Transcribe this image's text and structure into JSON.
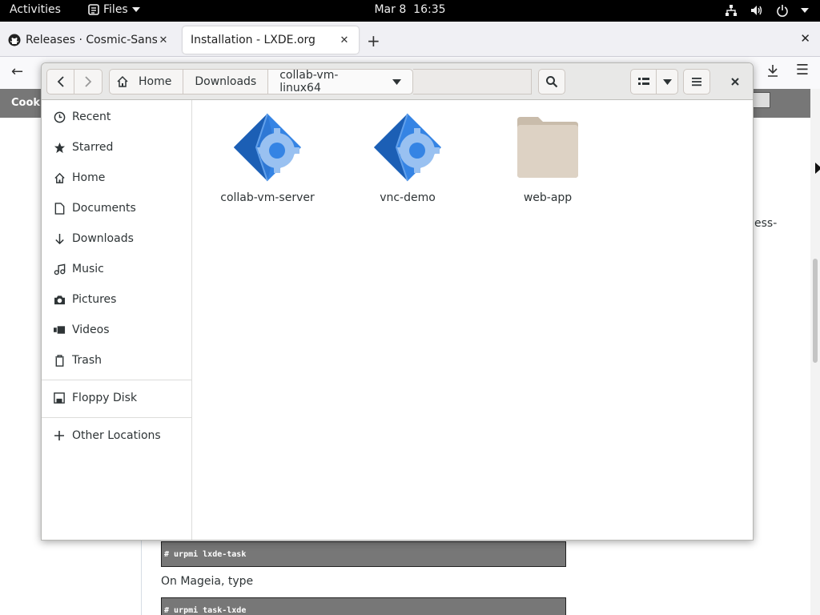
{
  "topbar": {
    "activities": "Activities",
    "app_menu": "Files",
    "date": "Mar 8",
    "time": "16:35"
  },
  "browser": {
    "tabs": [
      {
        "title": "Releases · Cosmic-Sans/c",
        "favicon": "github-icon"
      },
      {
        "title": "Installation - LXDE.org",
        "favicon": "none"
      }
    ],
    "cookie_text": "Cooki",
    "right_frag1": ",",
    "right_frag2": "ess-",
    "code1": "# urpmi lxde-task",
    "mageia_text": "On Mageia, type",
    "code2": "# urpmi task-lxde"
  },
  "filemanager": {
    "path": [
      {
        "label": "Home",
        "icon": "home-icon"
      },
      {
        "label": "Downloads"
      },
      {
        "label": "collab-vm-linux64"
      }
    ],
    "sidebar": [
      {
        "label": "Recent",
        "icon": "clock-icon"
      },
      {
        "label": "Starred",
        "icon": "star-icon"
      },
      {
        "label": "Home",
        "icon": "home-icon"
      },
      {
        "label": "Documents",
        "icon": "document-icon"
      },
      {
        "label": "Downloads",
        "icon": "download-icon"
      },
      {
        "label": "Music",
        "icon": "music-icon"
      },
      {
        "label": "Pictures",
        "icon": "camera-icon"
      },
      {
        "label": "Videos",
        "icon": "video-icon"
      },
      {
        "label": "Trash",
        "icon": "trash-icon"
      },
      {
        "label": "Floppy Disk",
        "icon": "floppy-icon"
      },
      {
        "label": "Other Locations",
        "icon": "plus-icon"
      }
    ],
    "files": [
      {
        "name": "collab-vm-server",
        "type": "executable"
      },
      {
        "name": "vnc-demo",
        "type": "executable"
      },
      {
        "name": "web-app",
        "type": "folder"
      }
    ]
  },
  "colors": {
    "topbar_bg": "#000000",
    "exec_blue": "#3584e4",
    "folder_beige": "#ddd2c4"
  }
}
